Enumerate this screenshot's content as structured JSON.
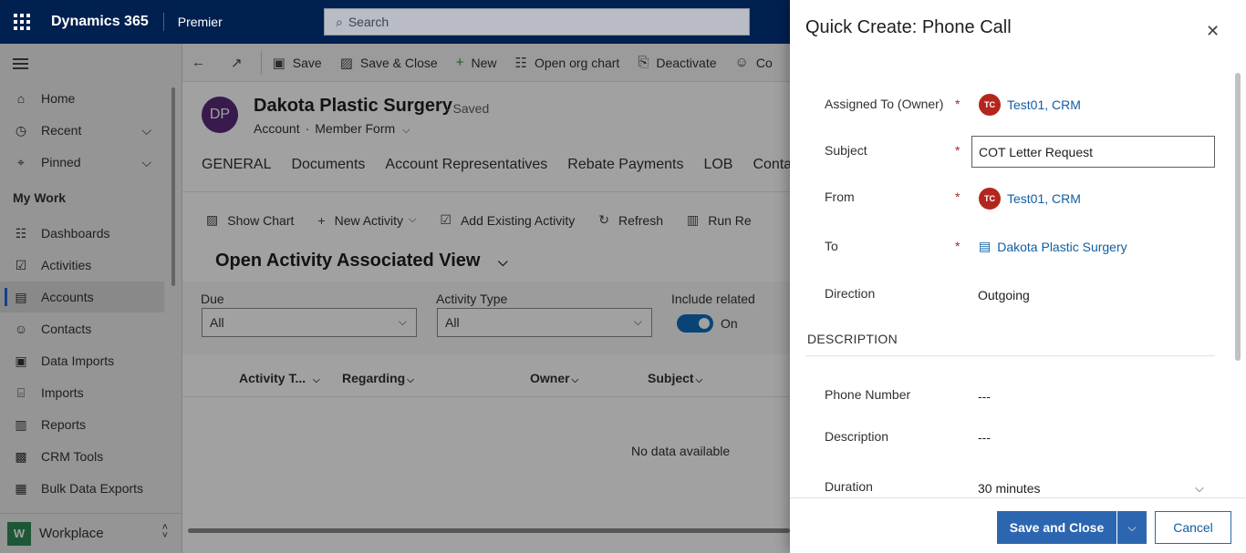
{
  "topbar": {
    "app_name": "Dynamics 365",
    "area": "Premier",
    "search_placeholder": "Search"
  },
  "sidebar": {
    "items": [
      {
        "label": "Home",
        "icon": "home-icon"
      },
      {
        "label": "Recent",
        "icon": "clock-icon",
        "expandable": true
      },
      {
        "label": "Pinned",
        "icon": "pin-icon",
        "expandable": true
      }
    ],
    "section": "My Work",
    "work_items": [
      {
        "label": "Dashboards",
        "icon": "dashboard-icon"
      },
      {
        "label": "Activities",
        "icon": "clipboard-icon"
      },
      {
        "label": "Accounts",
        "icon": "account-icon",
        "active": true
      },
      {
        "label": "Contacts",
        "icon": "person-icon"
      },
      {
        "label": "Data Imports",
        "icon": "import-icon"
      },
      {
        "label": "Imports",
        "icon": "import-doc-icon"
      },
      {
        "label": "Reports",
        "icon": "report-icon"
      },
      {
        "label": "CRM Tools",
        "icon": "tools-icon"
      },
      {
        "label": "Bulk Data Exports",
        "icon": "export-icon"
      }
    ],
    "workplace": {
      "badge": "W",
      "label": "Workplace"
    }
  },
  "commandbar": {
    "save": "Save",
    "save_close": "Save & Close",
    "new": "New",
    "org_chart": "Open org chart",
    "deactivate": "Deactivate",
    "more": "Co"
  },
  "record": {
    "initials": "DP",
    "title": "Dakota Plastic Surgery",
    "saved": "- Saved",
    "entity": "Account",
    "form": "Member Form"
  },
  "tabs": [
    "GENERAL",
    "Documents",
    "Account Representatives",
    "Rebate Payments",
    "LOB",
    "Contact A"
  ],
  "subgrid": {
    "commands": {
      "show_chart": "Show Chart",
      "new_activity": "New Activity",
      "add_existing": "Add Existing Activity",
      "refresh": "Refresh",
      "run_report": "Run Re"
    },
    "view_title": "Open Activity Associated View",
    "filters": {
      "due_label": "Due",
      "due_value": "All",
      "type_label": "Activity Type",
      "type_value": "All",
      "include_label": "Include related",
      "include_value": "On"
    },
    "columns": [
      "Activity T...",
      "Regarding",
      "Owner",
      "Subject"
    ],
    "empty_text": "No data available"
  },
  "quick_create": {
    "title": "Quick Create: Phone Call",
    "fields": {
      "owner_label": "Assigned To (Owner)",
      "owner_initials": "TC",
      "owner_value": "Test01, CRM",
      "subject_label": "Subject",
      "subject_value": "COT Letter Request",
      "from_label": "From",
      "from_initials": "TC",
      "from_value": "Test01, CRM",
      "to_label": "To",
      "to_value": "Dakota Plastic Surgery",
      "direction_label": "Direction",
      "direction_value": "Outgoing"
    },
    "description_section": "DESCRIPTION",
    "description_fields": {
      "phone_label": "Phone Number",
      "phone_value": "---",
      "desc_label": "Description",
      "desc_value": "---",
      "duration_label": "Duration",
      "duration_value": "30 minutes"
    },
    "footer": {
      "save_close": "Save and Close",
      "cancel": "Cancel"
    }
  }
}
